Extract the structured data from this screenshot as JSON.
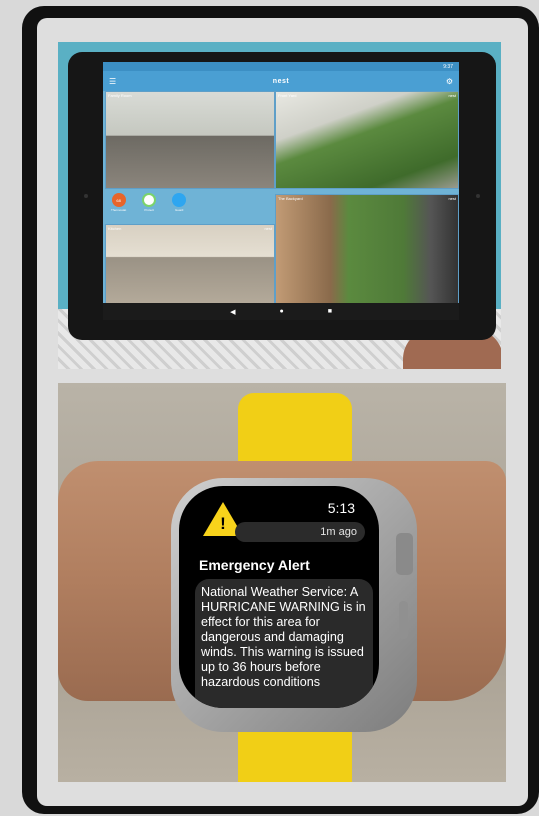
{
  "tablet_app": {
    "status_time": "9:37",
    "brand": "nest",
    "menu_icon": "hamburger-icon",
    "settings_icon": "gear-icon",
    "cameras": [
      {
        "label": "Family Room"
      },
      {
        "label": "Front Yard"
      },
      {
        "label": "Kitchen"
      },
      {
        "label": "The Backyard"
      }
    ],
    "camera_badge": "nest",
    "quick_actions": [
      {
        "label": "Thermostat",
        "value": "68",
        "color": "#e8652a"
      },
      {
        "label": "Protect",
        "color": "#7bd36b"
      },
      {
        "label": "Guard",
        "color": "#2ea6f0"
      }
    ],
    "nav_buttons": [
      "back-icon",
      "home-icon",
      "recents-icon"
    ]
  },
  "watch_alert": {
    "time": "5:13",
    "age": "1m ago",
    "title": "Emergency Alert",
    "body": "National Weather Service: A HURRICANE WARNING is in effect for this area for dangerous and damaging winds. This warning is issued up to 36 hours before hazardous conditions",
    "warning_color": "#f8d31b",
    "band_color": "#f1cf16"
  }
}
